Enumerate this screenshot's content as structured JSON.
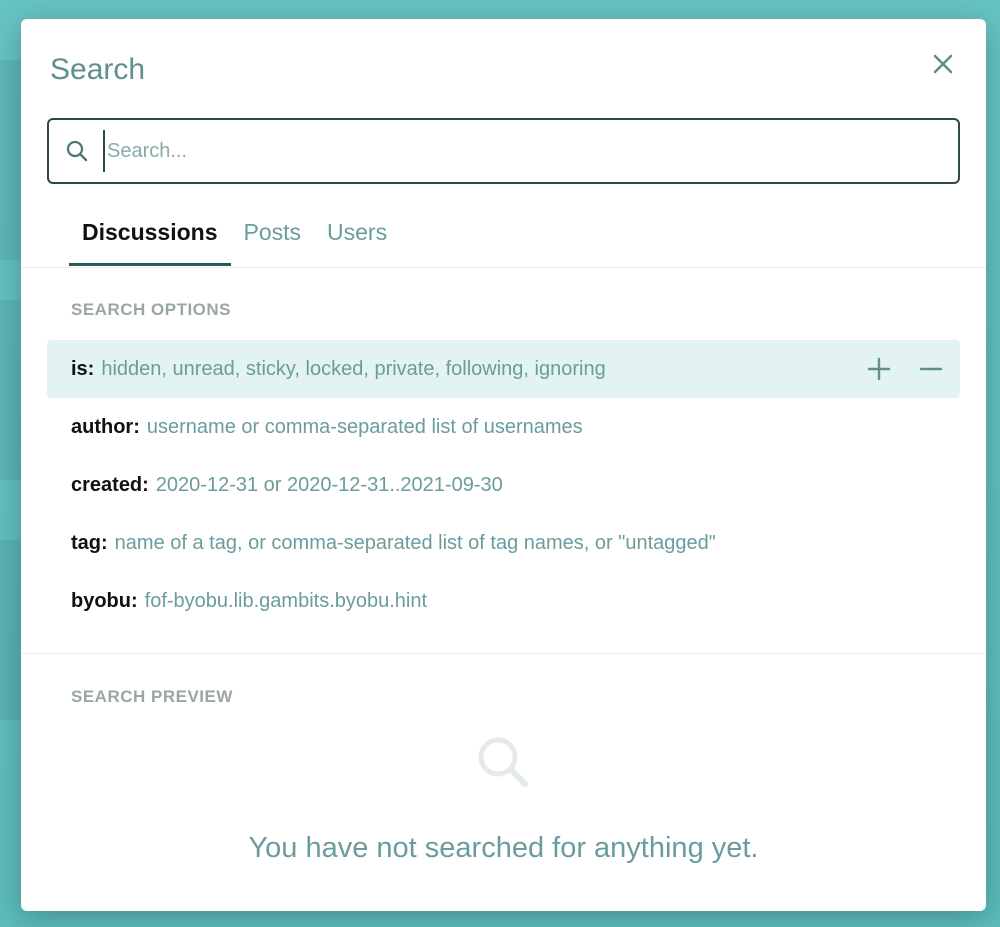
{
  "modal": {
    "title": "Search",
    "close_icon": "close-icon"
  },
  "search": {
    "placeholder": "Search...",
    "value": "",
    "icon": "search-icon"
  },
  "tabs": [
    {
      "label": "Discussions",
      "active": true
    },
    {
      "label": "Posts",
      "active": false
    },
    {
      "label": "Users",
      "active": false
    }
  ],
  "search_options": {
    "heading": "SEARCH OPTIONS",
    "items": [
      {
        "key": "is:",
        "hint": "hidden, unread, sticky, locked, private, following, ignoring",
        "highlighted": true
      },
      {
        "key": "author:",
        "hint": "username or comma-separated list of usernames",
        "highlighted": false
      },
      {
        "key": "created:",
        "hint": "2020-12-31 or 2020-12-31..2021-09-30",
        "highlighted": false
      },
      {
        "key": "tag:",
        "hint": "name of a tag, or comma-separated list of tag names, or \"untagged\"",
        "highlighted": false
      },
      {
        "key": "byobu:",
        "hint": "fof-byobu.lib.gambits.byobu.hint",
        "highlighted": false
      }
    ],
    "add_icon": "plus-icon",
    "remove_icon": "minus-icon"
  },
  "search_preview": {
    "heading": "SEARCH PREVIEW",
    "empty_icon": "search-icon",
    "empty_message": "You have not searched for anything yet."
  },
  "colors": {
    "backdrop": "#5fbfbf",
    "accent": "#2c5858",
    "muted_text": "#6b9c9c",
    "highlight_row": "#e3f3f2"
  }
}
